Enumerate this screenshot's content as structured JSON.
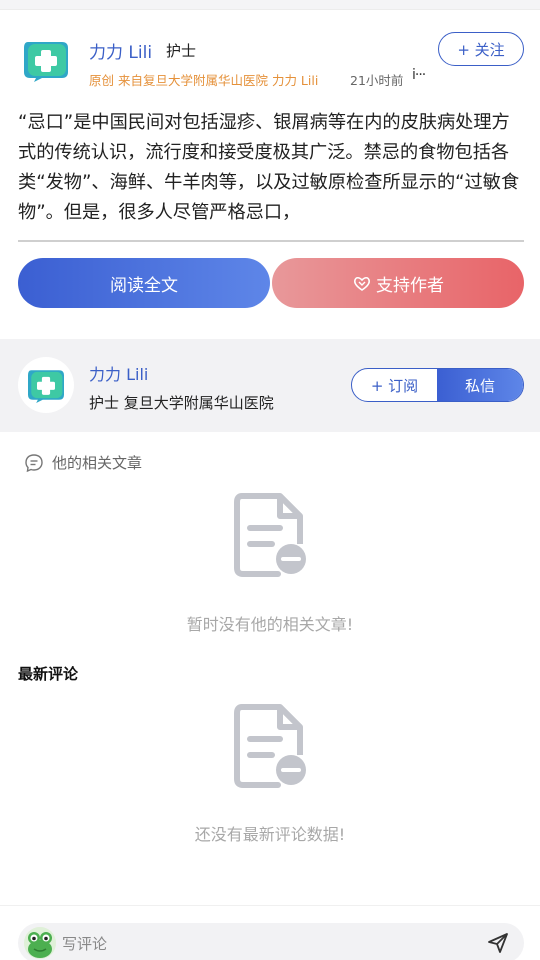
{
  "header": {
    "author_name": "力力 Lili",
    "author_role": "护士",
    "follow_label": "+ 关注",
    "meta": "原创 来自复旦大学附属华山医院 力力 Lili",
    "time": "21小时前",
    "more": "i···"
  },
  "article": {
    "excerpt": "“忌口”是中国民间对包括湿疹、银屑病等在内的皮肤病处理方式的传统认识，流行度和接受度极其广泛。禁忌的食物包括各类“发物”、海鲜、牛羊肉等，以及过敏原检查所显示的“过敏食物”。但是，很多人尽管严格忌口，"
  },
  "actions": {
    "read_full": "阅读全文",
    "support_author": "支持作者"
  },
  "author_card": {
    "name": "力力 Lili",
    "description": "护士 复旦大学附属华山医院",
    "subscribe_label": "+ 订阅",
    "message_label": "私信"
  },
  "related": {
    "title": "他的相关文章",
    "empty_text": "暂时没有他的相关文章!"
  },
  "comments": {
    "title": "最新评论",
    "empty_text": "还没有最新评论数据!",
    "input_placeholder": "写评论"
  },
  "colors": {
    "accent": "#3b5fc7",
    "support": "#e86468",
    "meta_orange": "#e5913a",
    "logo_teal": "#3cc2b0"
  },
  "icons": [
    "medical-cross-logo-icon",
    "more-icon",
    "heart-flower-icon",
    "comment-bubble-icon",
    "empty-document-icon",
    "frog-avatar-icon",
    "send-icon"
  ]
}
